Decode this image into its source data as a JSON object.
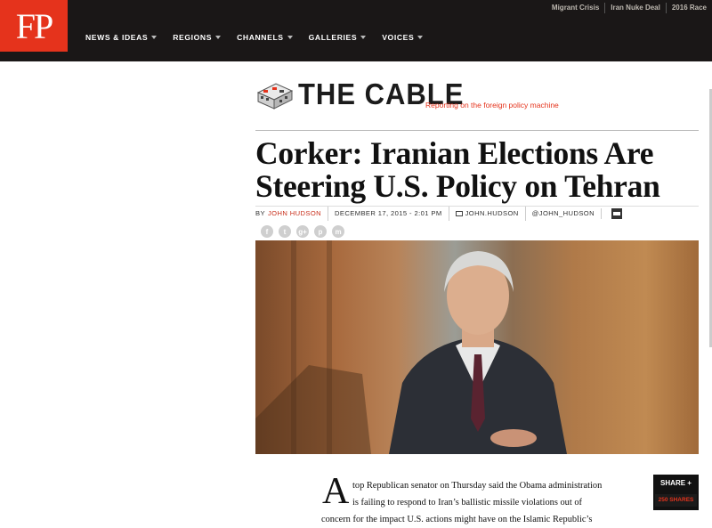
{
  "header": {
    "logo_text": "FP",
    "utility_links": [
      "Migrant Crisis",
      "Iran Nuke Deal",
      "2016 Race"
    ],
    "nav": [
      "NEWS & IDEAS",
      "REGIONS",
      "CHANNELS",
      "GALLERIES",
      "VOICES"
    ]
  },
  "section": {
    "title": "THE CABLE",
    "tagline": "Reporting on the foreign policy machine"
  },
  "article": {
    "headline_line1": "Corker: Iranian Elections Are",
    "headline_line2": "Steering U.S. Policy on Tehran",
    "by": "BY",
    "author": "JOHN HUDSON",
    "date": "DECEMBER 17, 2015 - 2:01 PM",
    "email": "JOHN.HUDSON",
    "twitter": "@JOHN_HUDSON",
    "dropcap": "A",
    "line1": "top Republican senator on Thursday said the Obama administration",
    "line2": "is failing to respond to Iran’s ballistic missile violations out of",
    "line3": "concern for the impact U.S. actions might have on the Islamic Republic’s"
  },
  "share_buttons": [
    "f",
    "t",
    "g+",
    "p",
    "m"
  ],
  "sharebox": {
    "label": "SHARE +",
    "count": "250 SHARES"
  },
  "colors": {
    "brand_red": "#e5331c",
    "topbar": "#1a1717"
  }
}
